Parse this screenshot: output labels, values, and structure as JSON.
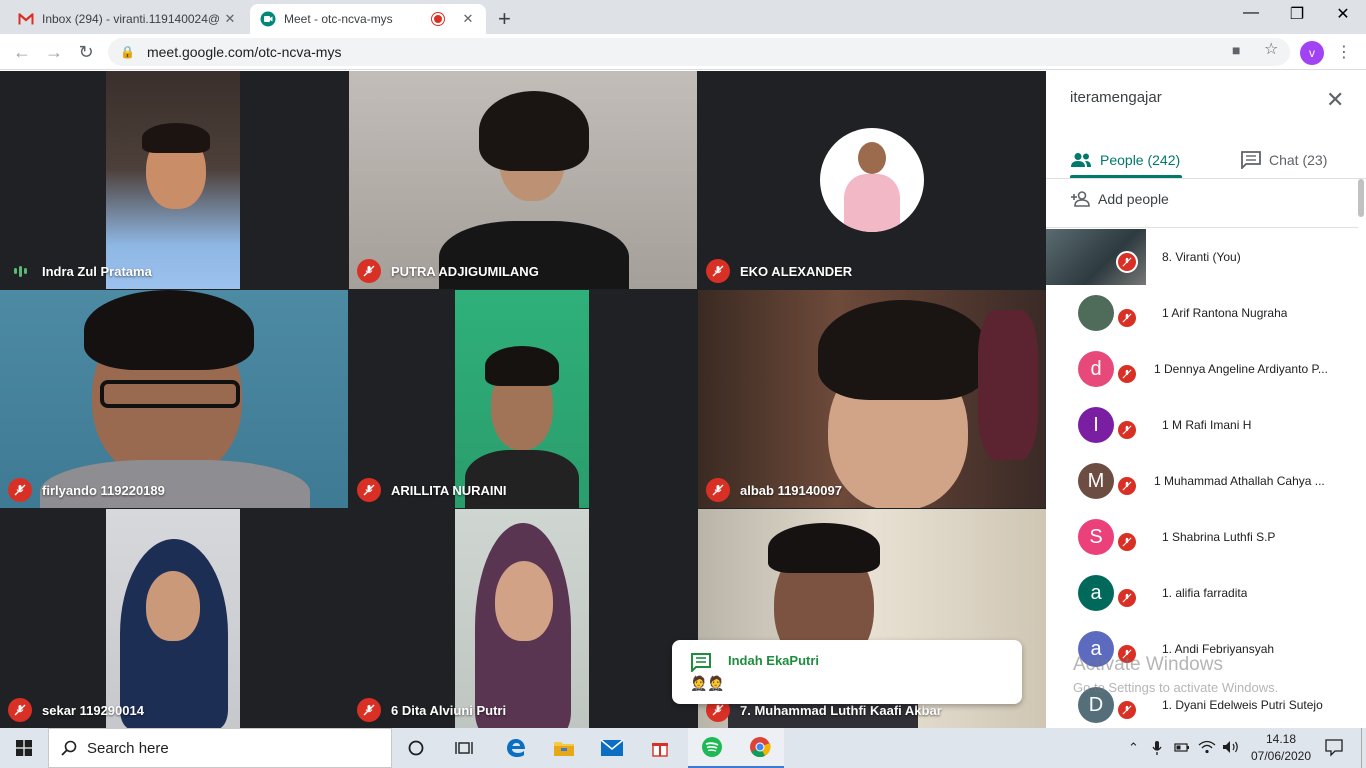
{
  "browser": {
    "tabs": [
      {
        "title": "Inbox (294) - viranti.119140024@",
        "icon": "gmail-icon"
      },
      {
        "title": "Meet - otc-ncva-mys",
        "icon": "meet-icon",
        "recording": true
      }
    ],
    "url": "meet.google.com/otc-ncva-mys",
    "profile_initial": "v"
  },
  "meeting": {
    "tiles": [
      {
        "name": "Indra Zul Pratama",
        "status": "speaking"
      },
      {
        "name": "PUTRA ADJIGUMILANG",
        "status": "muted"
      },
      {
        "name": "EKO ALEXANDER",
        "status": "muted"
      },
      {
        "name": "firlyando 119220189",
        "status": "muted"
      },
      {
        "name": "ARILLITA NURAINI",
        "status": "muted"
      },
      {
        "name": "albab 119140097",
        "status": "muted"
      },
      {
        "name": "sekar 119290014",
        "status": "muted"
      },
      {
        "name": "6 Dita Alviuni Putri",
        "status": "muted"
      },
      {
        "name": "7. Muhammad Luthfi Kaafi Akbar",
        "status": "muted"
      }
    ],
    "notification": {
      "sender": "Indah EkaPutri",
      "message": "🤵🤵"
    }
  },
  "panel": {
    "title": "iteramengajar",
    "people_tab": "People (242)",
    "chat_tab": "Chat (23)",
    "add_people": "Add people",
    "participants": [
      {
        "name": "8. Viranti (You)",
        "initial": "",
        "color": "",
        "video": true
      },
      {
        "name": "1 Arif Rantona Nugraha",
        "initial": "",
        "color": "#4f6b5a",
        "photo": true
      },
      {
        "name": "1 Dennya Angeline Ardiyanto P...",
        "initial": "d",
        "color": "#e8497b"
      },
      {
        "name": "1 M Rafi Imani H",
        "initial": "I",
        "color": "#7b1fa2"
      },
      {
        "name": "1 Muhammad Athallah Cahya ...",
        "initial": "M",
        "color": "#6d4c41"
      },
      {
        "name": "1 Shabrina Luthfi S.P",
        "initial": "S",
        "color": "#ec407a"
      },
      {
        "name": "1. alifia farradita",
        "initial": "a",
        "color": "#00695c"
      },
      {
        "name": "1. Andi Febriyansyah",
        "initial": "a",
        "color": "#5c6bc0"
      },
      {
        "name": "1. Dyani Edelweis Putri Sutejo",
        "initial": "D",
        "color": "#546e7a"
      }
    ]
  },
  "watermark": {
    "line1": "Activate Windows",
    "line2": "Go to Settings to activate Windows."
  },
  "taskbar": {
    "search_placeholder": "Search here",
    "time": "14.18",
    "date": "07/06/2020"
  }
}
